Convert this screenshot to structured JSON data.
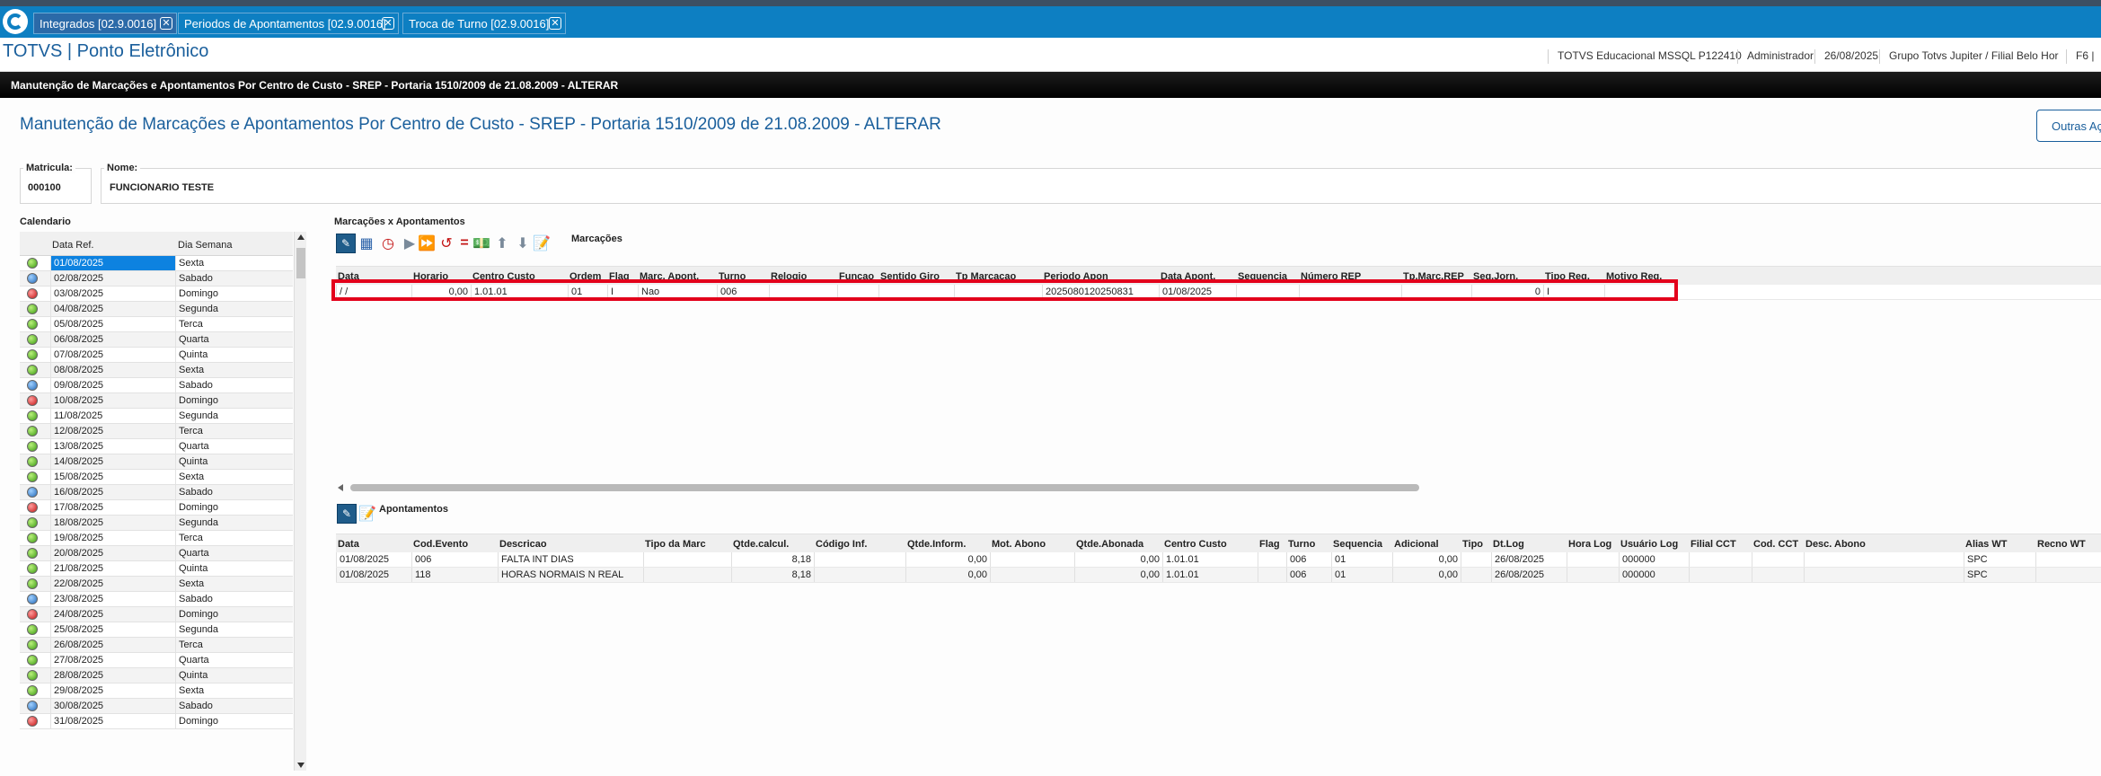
{
  "tabs": [
    {
      "label": "Integrados [02.9.0016]",
      "active": true
    },
    {
      "label": "Periodos de Apontamentos [02.9.0016]",
      "active": false
    },
    {
      "label": "Troca de Turno [02.9.0016]",
      "active": false
    }
  ],
  "header": {
    "title": "TOTVS | Ponto Eletrônico",
    "environment": "TOTVS Educacional MSSQL P122410",
    "user": "Administrador",
    "date": "26/08/2025",
    "branch": "Grupo Totvs Jupiter / Filial Belo Hor",
    "shortcut": "F6 |"
  },
  "dialog": {
    "bar_title": "Manutenção de Marcações e Apontamentos Por Centro de Custo - SREP - Portaria 1510/2009 de 21.08.2009 - ALTERAR",
    "page_title": "Manutenção de Marcações e Apontamentos Por Centro de Custo - SREP - Portaria 1510/2009 de 21.08.2009 - ALTERAR",
    "outras_button": "Outras Ações"
  },
  "fields": {
    "matricula_label": "Matricula:",
    "matricula_value": "000100",
    "nome_label": "Nome:",
    "nome_value": "FUNCIONARIO TESTE"
  },
  "calendar": {
    "title": "Calendario",
    "col_date": "Data Ref.",
    "col_day": "Dia Semana",
    "rows": [
      {
        "date": "01/08/2025",
        "day": "Sexta",
        "status": "green",
        "selected": true
      },
      {
        "date": "02/08/2025",
        "day": "Sabado",
        "status": "blue"
      },
      {
        "date": "03/08/2025",
        "day": "Domingo",
        "status": "red"
      },
      {
        "date": "04/08/2025",
        "day": "Segunda",
        "status": "green"
      },
      {
        "date": "05/08/2025",
        "day": "Terca",
        "status": "green"
      },
      {
        "date": "06/08/2025",
        "day": "Quarta",
        "status": "green"
      },
      {
        "date": "07/08/2025",
        "day": "Quinta",
        "status": "green"
      },
      {
        "date": "08/08/2025",
        "day": "Sexta",
        "status": "green"
      },
      {
        "date": "09/08/2025",
        "day": "Sabado",
        "status": "blue"
      },
      {
        "date": "10/08/2025",
        "day": "Domingo",
        "status": "red"
      },
      {
        "date": "11/08/2025",
        "day": "Segunda",
        "status": "green"
      },
      {
        "date": "12/08/2025",
        "day": "Terca",
        "status": "green"
      },
      {
        "date": "13/08/2025",
        "day": "Quarta",
        "status": "green"
      },
      {
        "date": "14/08/2025",
        "day": "Quinta",
        "status": "green"
      },
      {
        "date": "15/08/2025",
        "day": "Sexta",
        "status": "green"
      },
      {
        "date": "16/08/2025",
        "day": "Sabado",
        "status": "blue"
      },
      {
        "date": "17/08/2025",
        "day": "Domingo",
        "status": "red"
      },
      {
        "date": "18/08/2025",
        "day": "Segunda",
        "status": "green"
      },
      {
        "date": "19/08/2025",
        "day": "Terca",
        "status": "green"
      },
      {
        "date": "20/08/2025",
        "day": "Quarta",
        "status": "green"
      },
      {
        "date": "21/08/2025",
        "day": "Quinta",
        "status": "green"
      },
      {
        "date": "22/08/2025",
        "day": "Sexta",
        "status": "green"
      },
      {
        "date": "23/08/2025",
        "day": "Sabado",
        "status": "blue"
      },
      {
        "date": "24/08/2025",
        "day": "Domingo",
        "status": "red"
      },
      {
        "date": "25/08/2025",
        "day": "Segunda",
        "status": "green"
      },
      {
        "date": "26/08/2025",
        "day": "Terca",
        "status": "green"
      },
      {
        "date": "27/08/2025",
        "day": "Quarta",
        "status": "green"
      },
      {
        "date": "28/08/2025",
        "day": "Quinta",
        "status": "green"
      },
      {
        "date": "29/08/2025",
        "day": "Sexta",
        "status": "green"
      },
      {
        "date": "30/08/2025",
        "day": "Sabado",
        "status": "blue"
      },
      {
        "date": "31/08/2025",
        "day": "Domingo",
        "status": "red"
      }
    ]
  },
  "marcacoes": {
    "title": "Marcações x Apontamentos",
    "toolbar_label": "Marcações",
    "columns": [
      "Data",
      "Horario",
      "Centro Custo",
      "Ordem",
      "Flag",
      "Marc. Apont.",
      "Turno",
      "Relogio",
      "Funcao",
      "Sentido Giro",
      "Tp Marcacao",
      "Periodo Apon",
      "Data Apont.",
      "Sequencia",
      "Número REP",
      "Tp.Marc.REP",
      "Seq.Jorn.",
      "Tipo Reg.",
      "Motivo Reg."
    ],
    "rows": [
      [
        "/ /",
        "0,00",
        "1.01.01",
        "01",
        "I",
        "Nao",
        "006",
        "",
        "",
        "",
        "",
        "2025080120250831",
        "01/08/2025",
        "",
        "",
        "",
        "0",
        "I",
        ""
      ]
    ]
  },
  "apontamentos": {
    "toolbar_label": "Apontamentos",
    "columns": [
      "Data",
      "Cod.Evento",
      "Descricao",
      "Tipo da Marc",
      "Qtde.calcul.",
      "Código Inf.",
      "Qtde.Inform.",
      "Mot. Abono",
      "Qtde.Abonada",
      "Centro Custo",
      "Flag",
      "Turno",
      "Sequencia",
      "Adicional",
      "Tipo",
      "Dt.Log",
      "Hora Log",
      "Usuário Log",
      "Filial CCT",
      "Cod. CCT",
      "Desc. Abono",
      "Alias WT",
      "Recno WT"
    ],
    "rows": [
      [
        "01/08/2025",
        "006",
        "FALTA INT DIAS",
        "",
        "8,18",
        "",
        "0,00",
        "",
        "0,00",
        "1.01.01",
        "",
        "006",
        "01",
        "0,00",
        "",
        "26/08/2025",
        "",
        "000000",
        "",
        "",
        "",
        "SPC",
        ""
      ],
      [
        "01/08/2025",
        "118",
        "HORAS NORMAIS N REAL",
        "",
        "8,18",
        "",
        "0,00",
        "",
        "0,00",
        "1.01.01",
        "",
        "006",
        "01",
        "0,00",
        "",
        "26/08/2025",
        "",
        "000000",
        "",
        "",
        "",
        "SPC",
        ""
      ]
    ]
  }
}
